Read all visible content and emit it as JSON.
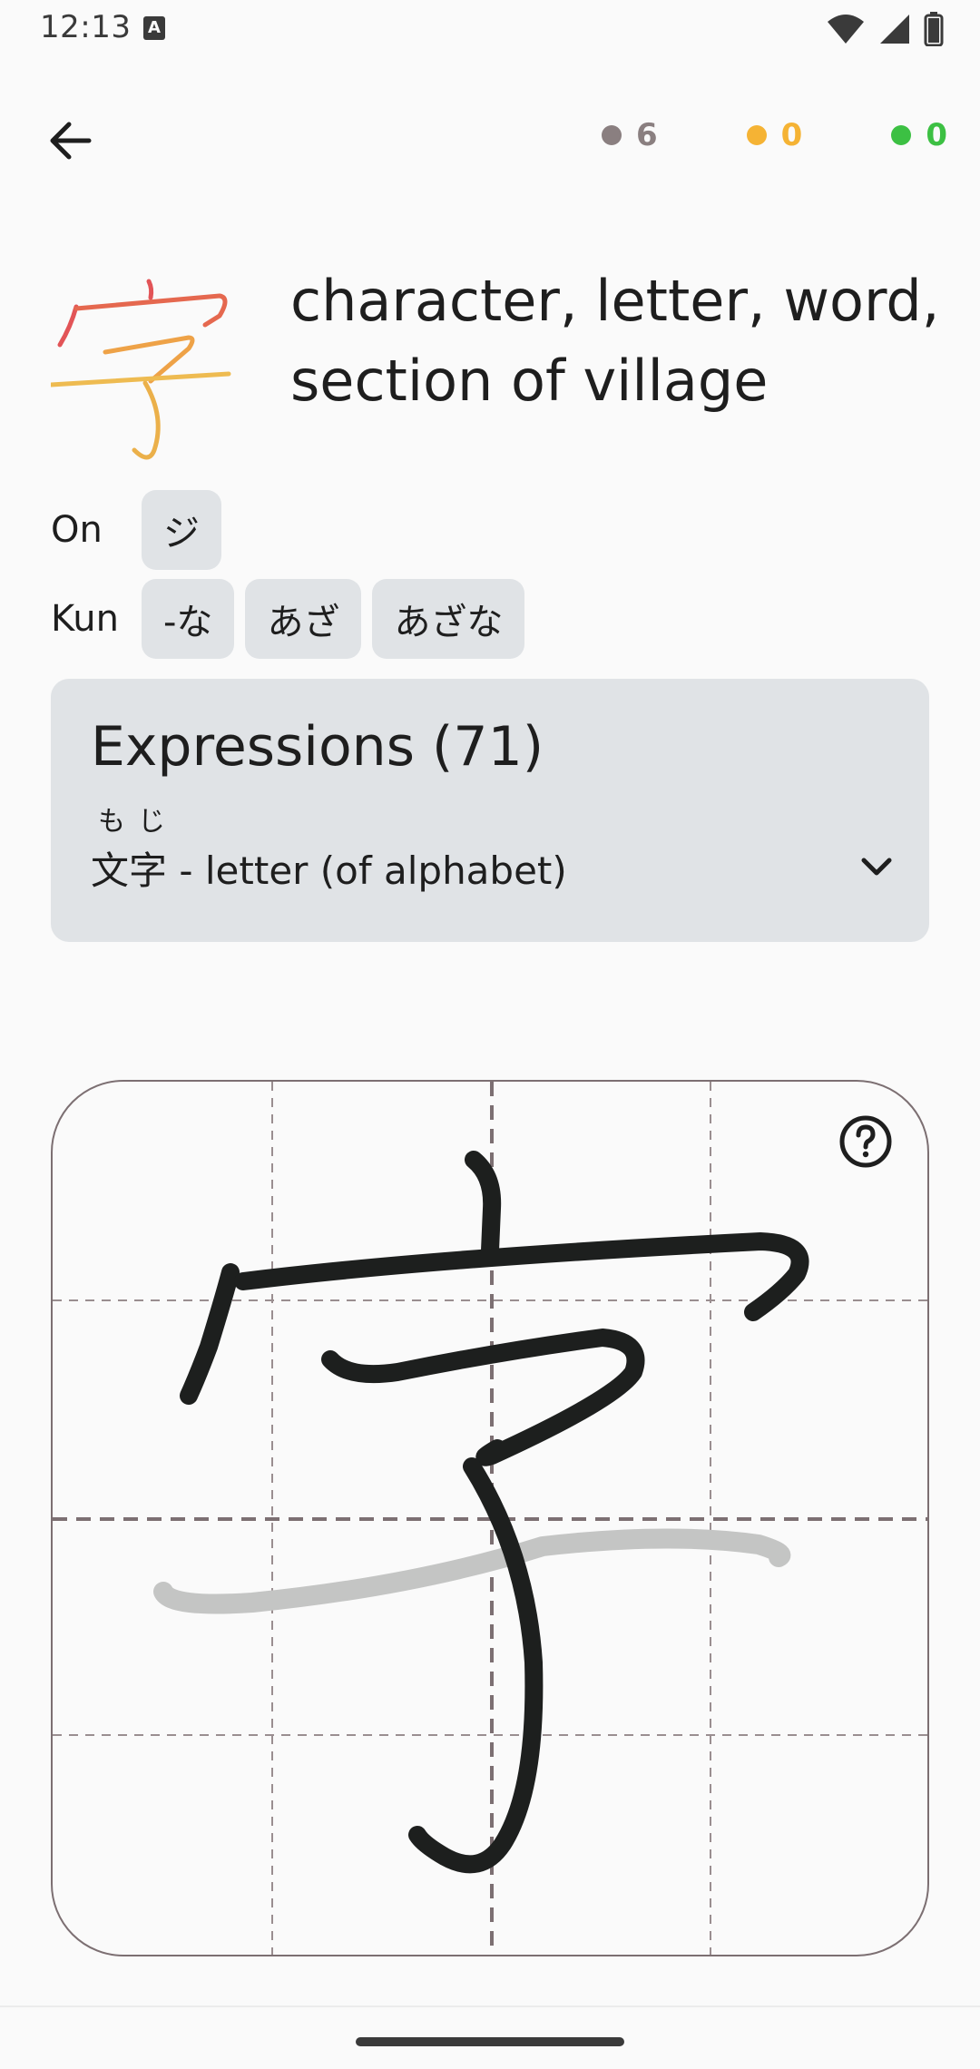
{
  "status_bar": {
    "time": "12:13",
    "notification_icon": "a-icon",
    "icons": [
      "wifi-icon",
      "signal-icon",
      "battery-icon"
    ]
  },
  "header": {
    "back_icon": "arrow-left-icon",
    "counters": [
      {
        "name": "new",
        "value": "6",
        "color": "#8a7f80"
      },
      {
        "name": "learning",
        "value": "0",
        "color": "#f5b334"
      },
      {
        "name": "learned",
        "value": "0",
        "color": "#3cc043"
      }
    ]
  },
  "kanji": {
    "character": "字",
    "meaning": "character, letter, word, section of village"
  },
  "readings": {
    "on_label": "On",
    "on": [
      "ジ"
    ],
    "kun_label": "Kun",
    "kun": [
      "-な",
      "あざ",
      "あざな"
    ]
  },
  "expressions": {
    "title": "Expressions (71)",
    "furigana": "もじ",
    "word": "文字",
    "separator": " - ",
    "meaning": "letter (of alphabet)",
    "expand_icon": "chevron-down-icon"
  },
  "canvas": {
    "help_icon": "help-circle-icon",
    "stroke_color": "#1d1f1e",
    "hint_stroke_color": "#c4c5c4"
  }
}
